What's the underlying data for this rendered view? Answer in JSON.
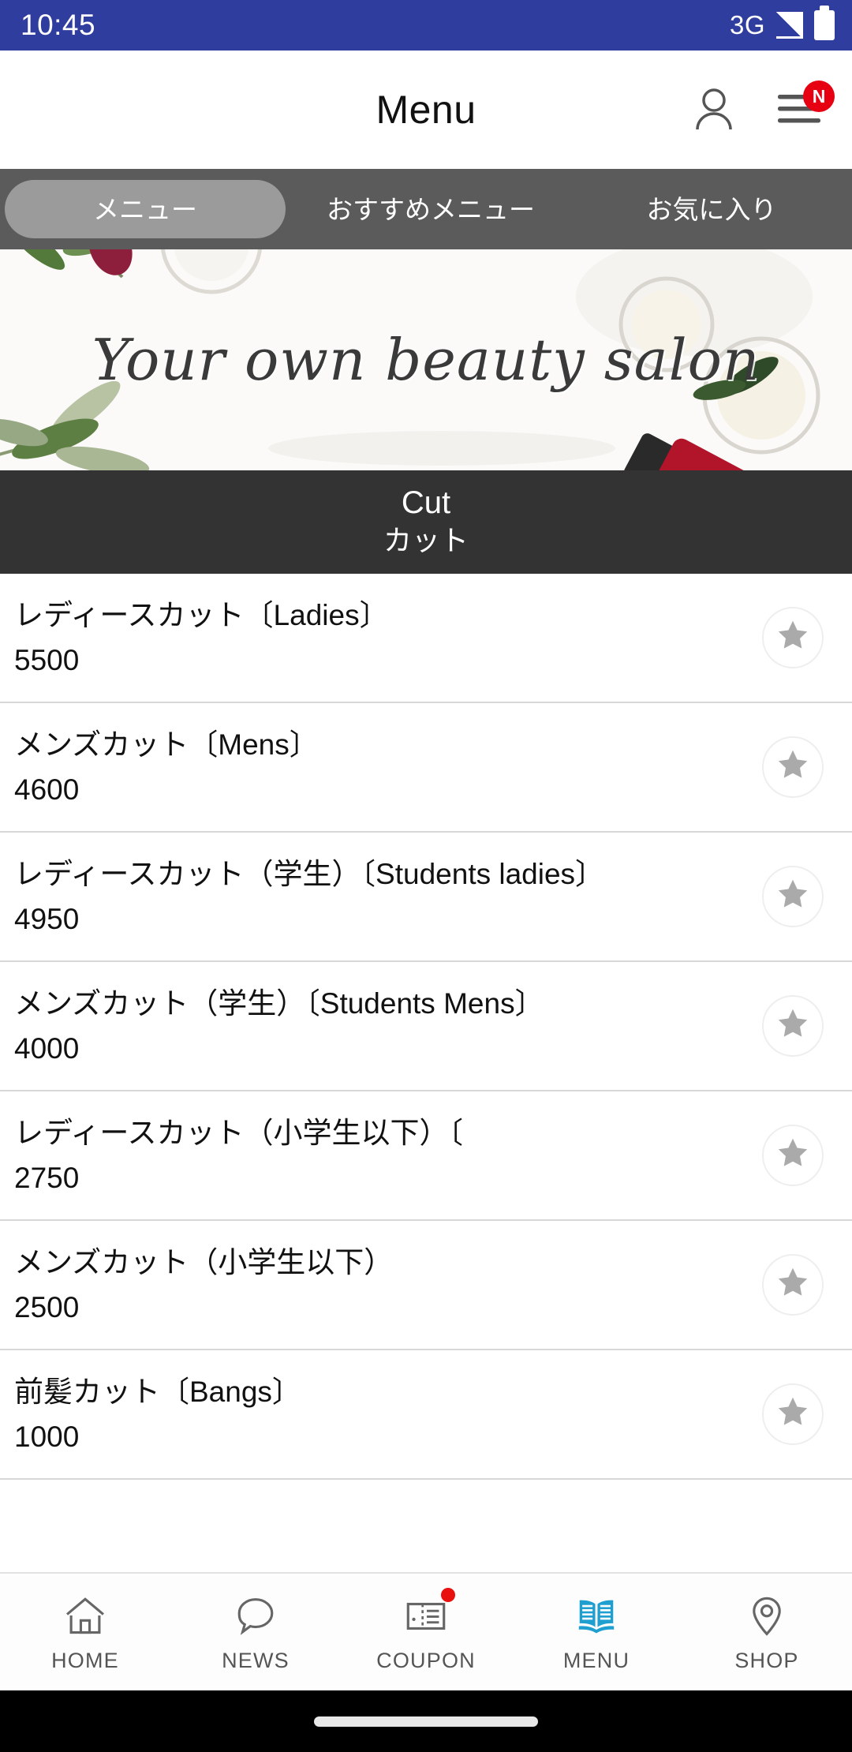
{
  "status_bar": {
    "time": "10:45",
    "network": "3G",
    "signal_icon": "signal-triangle-icon",
    "battery_icon": "battery-full-icon",
    "background_color": "#2f3d9e"
  },
  "header": {
    "title": "Menu",
    "account_icon": "person-icon",
    "menu_icon": "hamburger-menu-icon",
    "badge_label": "N",
    "badge_color": "#e60012"
  },
  "tabs": [
    {
      "label": "メニュー",
      "active": true
    },
    {
      "label": "おすすめメニュー",
      "active": false
    },
    {
      "label": "お気に入り",
      "active": false
    }
  ],
  "banner": {
    "headline": "Your own beauty salon",
    "alt": "cosmetic jars with olive branch and red dropper bottle on white background"
  },
  "section": {
    "title_en": "Cut",
    "title_jp": "カット",
    "background_color": "#333333"
  },
  "menu_items": [
    {
      "name": "レディースカット〔Ladies〕",
      "price": "5500",
      "favorite_icon": "star-icon"
    },
    {
      "name": "メンズカット〔Mens〕",
      "price": "4600",
      "favorite_icon": "star-icon"
    },
    {
      "name": "レディースカット（学生）〔Students ladies〕",
      "price": "4950",
      "favorite_icon": "star-icon"
    },
    {
      "name": "メンズカット（学生）〔Students Mens〕",
      "price": "4000",
      "favorite_icon": "star-icon"
    },
    {
      "name": "レディースカット（小学生以下）〔",
      "price": "2750",
      "favorite_icon": "star-icon"
    },
    {
      "name": "メンズカット（小学生以下）",
      "price": "2500",
      "favorite_icon": "star-icon"
    },
    {
      "name": "前髪カット〔Bangs〕",
      "price": "1000",
      "favorite_icon": "star-icon"
    }
  ],
  "bottom_nav": {
    "active_color": "#1f9fd0",
    "items": [
      {
        "label": "HOME",
        "icon": "home-icon",
        "active": false,
        "has_dot": false
      },
      {
        "label": "NEWS",
        "icon": "speech-bubble-icon",
        "active": false,
        "has_dot": false
      },
      {
        "label": "COUPON",
        "icon": "ticket-icon",
        "active": false,
        "has_dot": true
      },
      {
        "label": "MENU",
        "icon": "open-book-icon",
        "active": true,
        "has_dot": false
      },
      {
        "label": "SHOP",
        "icon": "map-pin-icon",
        "active": false,
        "has_dot": false
      }
    ]
  }
}
